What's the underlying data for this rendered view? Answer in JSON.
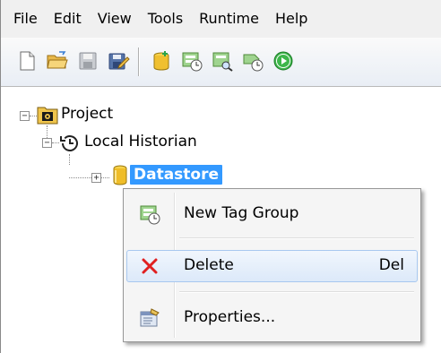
{
  "menubar": {
    "items": [
      "File",
      "Edit",
      "View",
      "Tools",
      "Runtime",
      "Help"
    ]
  },
  "toolbar": {
    "buttons": [
      {
        "icon": "new-document-icon"
      },
      {
        "icon": "open-folder-icon"
      },
      {
        "icon": "save-icon"
      },
      {
        "icon": "save-as-icon"
      },
      {
        "icon": "new-datastore-icon"
      },
      {
        "icon": "new-tag-group-icon"
      },
      {
        "icon": "find-tag-icon"
      },
      {
        "icon": "tag-group-settings-icon"
      },
      {
        "icon": "run-icon"
      }
    ]
  },
  "tree": {
    "root": {
      "label": "Project",
      "expander": "−"
    },
    "historian": {
      "label": "Local Historian",
      "expander": "−"
    },
    "datastore": {
      "label": "Datastore",
      "expander": "+",
      "selected": true
    }
  },
  "context_menu": {
    "items": [
      {
        "label": "New Tag Group",
        "shortcut": "",
        "icon": "new-tag-group-icon"
      },
      {
        "label": "Delete",
        "shortcut": "Del",
        "icon": "delete-x-icon",
        "highlighted": true
      },
      {
        "label": "Properties...",
        "shortcut": "",
        "icon": "properties-icon"
      }
    ]
  },
  "colors": {
    "selection": "#3399ff",
    "menu_bg": "#f0f0f0",
    "delete_red": "#e02020"
  }
}
